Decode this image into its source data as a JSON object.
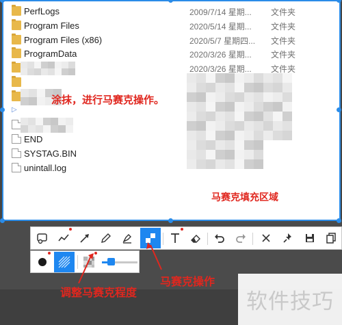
{
  "explorer": {
    "files": [
      {
        "name": "PerfLogs",
        "date": "2009/7/14 星期...",
        "type": "文件夹",
        "icon": "folder-icon"
      },
      {
        "name": "Program Files",
        "date": "2020/5/14 星期...",
        "type": "文件夹",
        "icon": "folder-icon"
      },
      {
        "name": "Program Files (x86)",
        "date": "2020/5/7 星期四...",
        "type": "文件夹",
        "icon": "folder-icon"
      },
      {
        "name": "ProgramData",
        "date": "2020/3/26 星期...",
        "type": "文件夹",
        "icon": "folder-icon"
      },
      {
        "name": "s",
        "date": "2020/3/26 星期...",
        "type": "文件夹",
        "icon": "folder-icon"
      },
      {
        "name": "",
        "date": "",
        "type": "",
        "icon": "folder-icon"
      },
      {
        "name": "",
        "date": "",
        "type": "",
        "icon": "folder-icon"
      },
      {
        "name": "",
        "date": "",
        "type": "",
        "icon": "shortcut-arrow-icon"
      },
      {
        "name": "",
        "date": "",
        "type": "",
        "icon": "file-icon"
      },
      {
        "name": "END",
        "date": "",
        "type": "",
        "icon": "file-icon"
      },
      {
        "name": "SYSTAG.BIN",
        "date": "",
        "type": "",
        "icon": "file-icon"
      },
      {
        "name": "unintall.log",
        "date": "",
        "type": "",
        "icon": "file-icon"
      }
    ]
  },
  "annotations": {
    "smear_text": "涂抹，进行马赛克操作。",
    "fill_area": "马赛克填充区域",
    "mosaic_op": "马赛克操作",
    "adjust_level": "调整马赛克程度"
  },
  "toolbar": {
    "tools": [
      {
        "id": "rect",
        "icon": "rect-callout-icon"
      },
      {
        "id": "line",
        "icon": "freehand-line-icon"
      },
      {
        "id": "arrow",
        "icon": "arrow-icon"
      },
      {
        "id": "pen",
        "icon": "pen-icon"
      },
      {
        "id": "highlighter",
        "icon": "highlighter-icon"
      },
      {
        "id": "mosaic",
        "icon": "mosaic-icon",
        "active": true
      },
      {
        "id": "text",
        "icon": "text-icon"
      },
      {
        "id": "eraser",
        "icon": "eraser-icon"
      },
      {
        "id": "undo",
        "icon": "undo-icon"
      },
      {
        "id": "redo",
        "icon": "redo-icon"
      },
      {
        "id": "close",
        "icon": "close-icon"
      },
      {
        "id": "pin",
        "icon": "pin-icon"
      },
      {
        "id": "save",
        "icon": "save-icon"
      },
      {
        "id": "copy",
        "icon": "copy-icon"
      }
    ]
  },
  "mosaic_options": {
    "level": 0.25
  },
  "watermark": {
    "text": "软件技巧"
  },
  "colors": {
    "accent": "#1e87f0",
    "selection": "#2b8ce8",
    "annotation": "#e0271f"
  }
}
